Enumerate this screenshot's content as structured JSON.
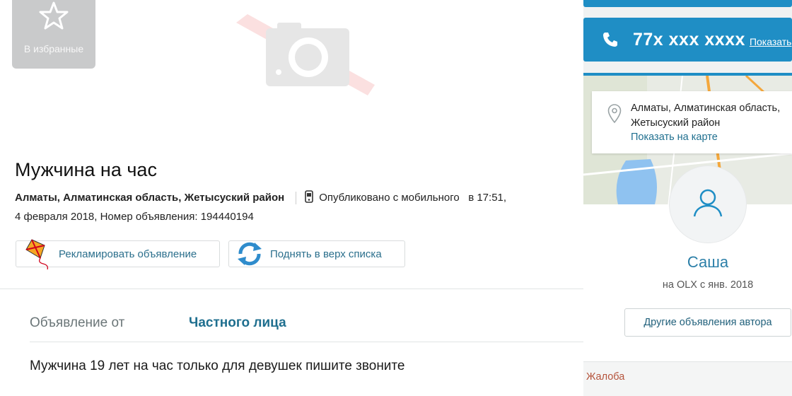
{
  "favorites": {
    "label": "В избранные"
  },
  "listing": {
    "title": "Мужчина на час",
    "location": "Алматы, Алматинская область, Жетысуский район",
    "published": "Опубликовано с мобильного",
    "time": "в 17:51,",
    "date_and_id": "4 февраля 2018, Номер объявления: 194440194"
  },
  "actions": {
    "promote": "Рекламировать объявление",
    "bump": "Поднять в верх списка"
  },
  "details": {
    "offer_from_label": "Объявление от",
    "offer_from_value": "Частного лица",
    "description": "Мужчина 19 лет на час только для девушек пишите звоните"
  },
  "sidebar": {
    "phone": "77x xxx xxxx",
    "show_phone": "Показать",
    "address": "Алматы, Алматинская область, Жетысуский район",
    "show_on_map": "Показать на карте",
    "user_name": "Саша",
    "member_since": "на OLX с янв. 2018",
    "other_ads": "Другие объявления автора",
    "complaint": "Жалоба"
  },
  "colors": {
    "accent": "#1f8ec5",
    "link": "#1f6f8f",
    "fav_bg": "#c9cacb",
    "complaint": "#b5543c"
  },
  "icons": [
    "star-icon",
    "camera-placeholder-icon",
    "mobile-phone-icon",
    "kite-icon",
    "refresh-icon",
    "phone-icon",
    "map-pin-icon",
    "user-icon"
  ]
}
